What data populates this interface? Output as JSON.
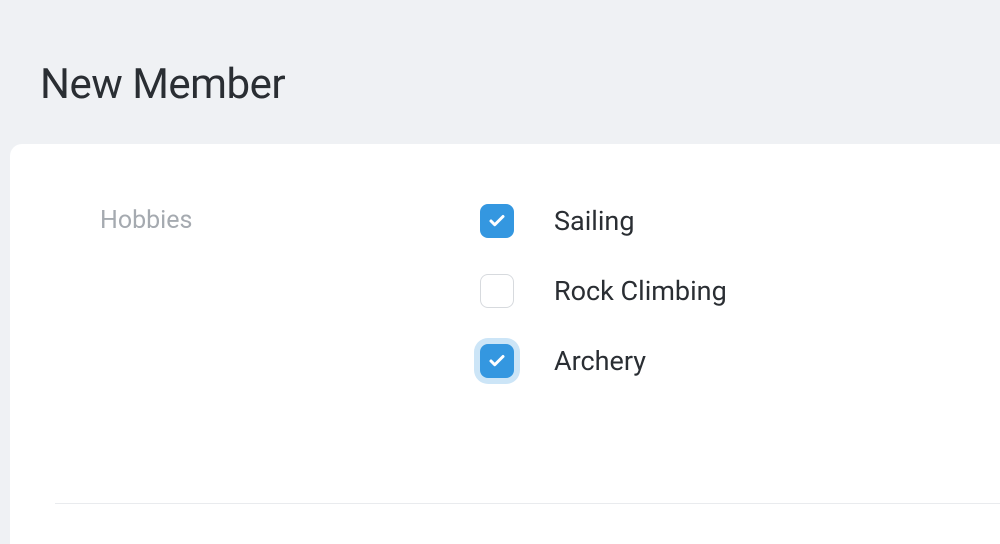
{
  "page": {
    "title": "New Member"
  },
  "form": {
    "hobbies": {
      "label": "Hobbies",
      "options": {
        "sailing": {
          "label": "Sailing",
          "checked": true,
          "focused": false
        },
        "rock_climbing": {
          "label": "Rock Climbing",
          "checked": false,
          "focused": false
        },
        "archery": {
          "label": "Archery",
          "checked": true,
          "focused": true
        }
      }
    }
  }
}
